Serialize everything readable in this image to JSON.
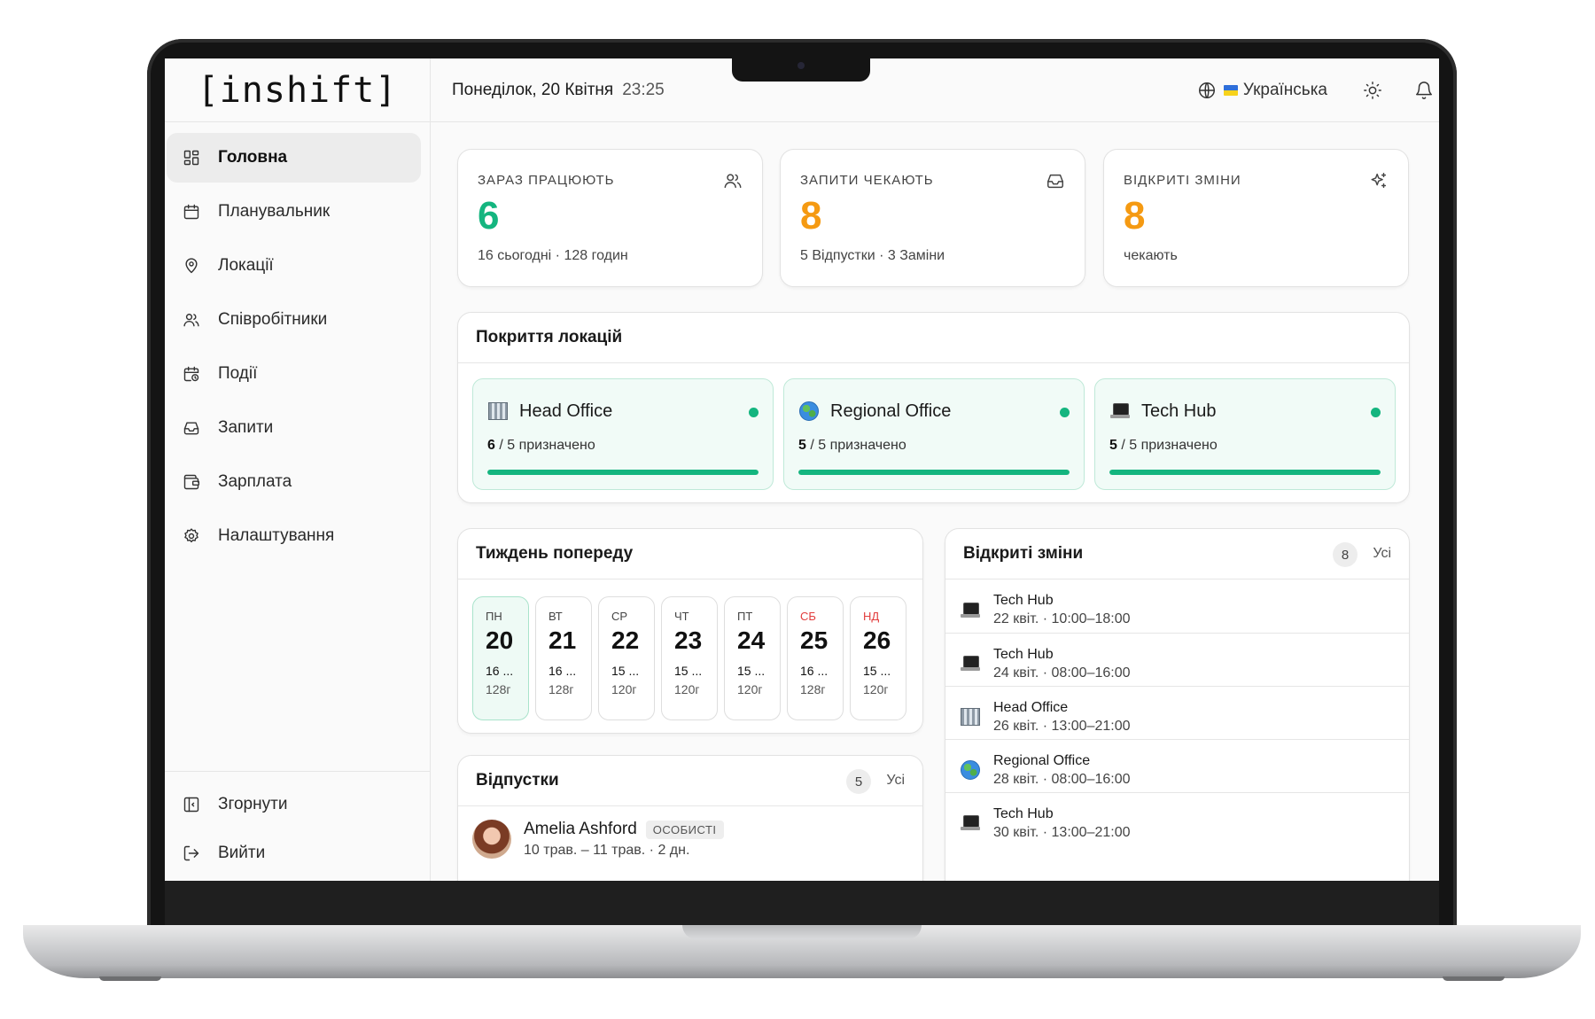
{
  "app": {
    "logo": "[inshift]"
  },
  "header": {
    "date": "Понеділок, 20 Квітня",
    "time": "23:25",
    "language": "Українська"
  },
  "sidebar": {
    "items": [
      {
        "label": "Головна",
        "icon": "grid-icon",
        "active": true
      },
      {
        "label": "Планувальник",
        "icon": "calendar-icon"
      },
      {
        "label": "Локації",
        "icon": "map-pin-icon"
      },
      {
        "label": "Співробітники",
        "icon": "users-icon"
      },
      {
        "label": "Події",
        "icon": "calendar-clock-icon"
      },
      {
        "label": "Запити",
        "icon": "inbox-icon"
      },
      {
        "label": "Зарплата",
        "icon": "wallet-icon"
      },
      {
        "label": "Налаштування",
        "icon": "gear-icon"
      }
    ],
    "collapse_label": "Згорнути",
    "logout_label": "Вийти"
  },
  "stats": [
    {
      "label": "Зараз працюють",
      "value": "6",
      "sub": "16 сьогодні · 128 годин",
      "icon": "users-icon",
      "color": "#14b57f"
    },
    {
      "label": "Запити чекають",
      "value": "8",
      "sub": "5 Відпустки · 3 Заміни",
      "icon": "inbox-icon",
      "color": "#f59a12"
    },
    {
      "label": "Відкриті зміни",
      "value": "8",
      "sub": "чекають",
      "icon": "sparkles-icon",
      "color": "#f59a12"
    }
  ],
  "coverage": {
    "title": "Покриття локацій",
    "locations": [
      {
        "name": "Head Office",
        "icon": "office-building-icon",
        "assigned": "6",
        "rest": " / 5 призначено",
        "fill": 1.0
      },
      {
        "name": "Regional Office",
        "icon": "globe-icon",
        "assigned": "5",
        "rest": " / 5 призначено",
        "fill": 1.0
      },
      {
        "name": "Tech Hub",
        "icon": "laptop-icon",
        "assigned": "5",
        "rest": " / 5 призначено",
        "fill": 1.0
      }
    ]
  },
  "week": {
    "title": "Тиждень попереду",
    "days": [
      {
        "name": "Пн",
        "num": "20",
        "count": "16 ...",
        "hours": "128г",
        "active": true
      },
      {
        "name": "Вт",
        "num": "21",
        "count": "16 ...",
        "hours": "128г"
      },
      {
        "name": "Ср",
        "num": "22",
        "count": "15 ...",
        "hours": "120г"
      },
      {
        "name": "Чт",
        "num": "23",
        "count": "15 ...",
        "hours": "120г"
      },
      {
        "name": "Пт",
        "num": "24",
        "count": "15 ...",
        "hours": "120г"
      },
      {
        "name": "Сб",
        "num": "25",
        "count": "16 ...",
        "hours": "128г",
        "weekend": true
      },
      {
        "name": "Нд",
        "num": "26",
        "count": "15 ...",
        "hours": "120г",
        "weekend": true
      }
    ]
  },
  "vacations": {
    "title": "Відпустки",
    "count": "5",
    "all_label": "Усі",
    "items": [
      {
        "name": "Amelia Ashford",
        "tag": "Особисті",
        "dates": "10 трав. – 11 трав. · 2 дн."
      }
    ]
  },
  "open_shifts": {
    "title": "Відкриті зміни",
    "count": "8",
    "all_label": "Усі",
    "items": [
      {
        "location": "Tech Hub",
        "icon": "laptop-icon",
        "time": "22 квіт. · 10:00–18:00"
      },
      {
        "location": "Tech Hub",
        "icon": "laptop-icon",
        "time": "24 квіт. · 08:00–16:00"
      },
      {
        "location": "Head Office",
        "icon": "office-building-icon",
        "time": "26 квіт. · 13:00–21:00"
      },
      {
        "location": "Regional Office",
        "icon": "globe-icon",
        "time": "28 квіт. · 08:00–16:00"
      },
      {
        "location": "Tech Hub",
        "icon": "laptop-icon",
        "time": "30 квіт. · 13:00–21:00"
      }
    ]
  }
}
